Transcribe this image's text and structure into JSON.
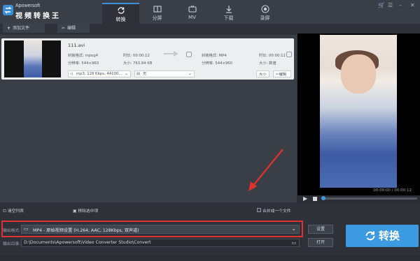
{
  "app": {
    "brand_small": "Apowersoft",
    "brand_title": "视频转换王"
  },
  "tabs": [
    {
      "label": "转换",
      "icon": "convert-icon",
      "active": true
    },
    {
      "label": "分屏",
      "icon": "split-screen-icon",
      "active": false
    },
    {
      "label": "MV",
      "icon": "mv-icon",
      "active": false
    },
    {
      "label": "下载",
      "icon": "download-icon",
      "active": false
    },
    {
      "label": "录屏",
      "icon": "record-icon",
      "active": false
    }
  ],
  "toolbar": {
    "add_file": "添加文件",
    "edit": "编辑"
  },
  "file": {
    "name": "111.avi",
    "src_format_label": "封装格式: mpeg4",
    "src_resolution_label": "分辨率: 544×960",
    "src_duration_label": "时长: 00:00:12",
    "src_size_label": "大小: 763.84 KB",
    "dst_format_label": "封装格式: MP4",
    "dst_resolution_label": "分辨率: 544×960",
    "dst_duration_label": "时长: 00:00:12",
    "dst_size_label": "大小: 数值",
    "audio_select": "mp3, 128 Kbps, 44100...",
    "subtitle_select": "无",
    "size_button": "大小",
    "edit_button": "编辑"
  },
  "bottom": {
    "clear_list": "清空列表",
    "remove_selected": "移除选中项",
    "merge_label": "合并成一个文件",
    "format_label": "输出格式:",
    "format_value": "MP4 - 原始视频设置 (H.264; AAC, 128Kbps, 双声道)",
    "dir_label": "输出目录:",
    "dir_value": "D:\\Documents\\Apowersoft\\Video Converter Studio\\Convert",
    "settings_button": "设置",
    "open_button": "打开",
    "convert_button": "转换"
  },
  "player": {
    "time": "00:00:00 / 00:00:12",
    "progress": 0
  },
  "colors": {
    "accent": "#3b9ae0",
    "annotation_red": "#e0322e"
  }
}
